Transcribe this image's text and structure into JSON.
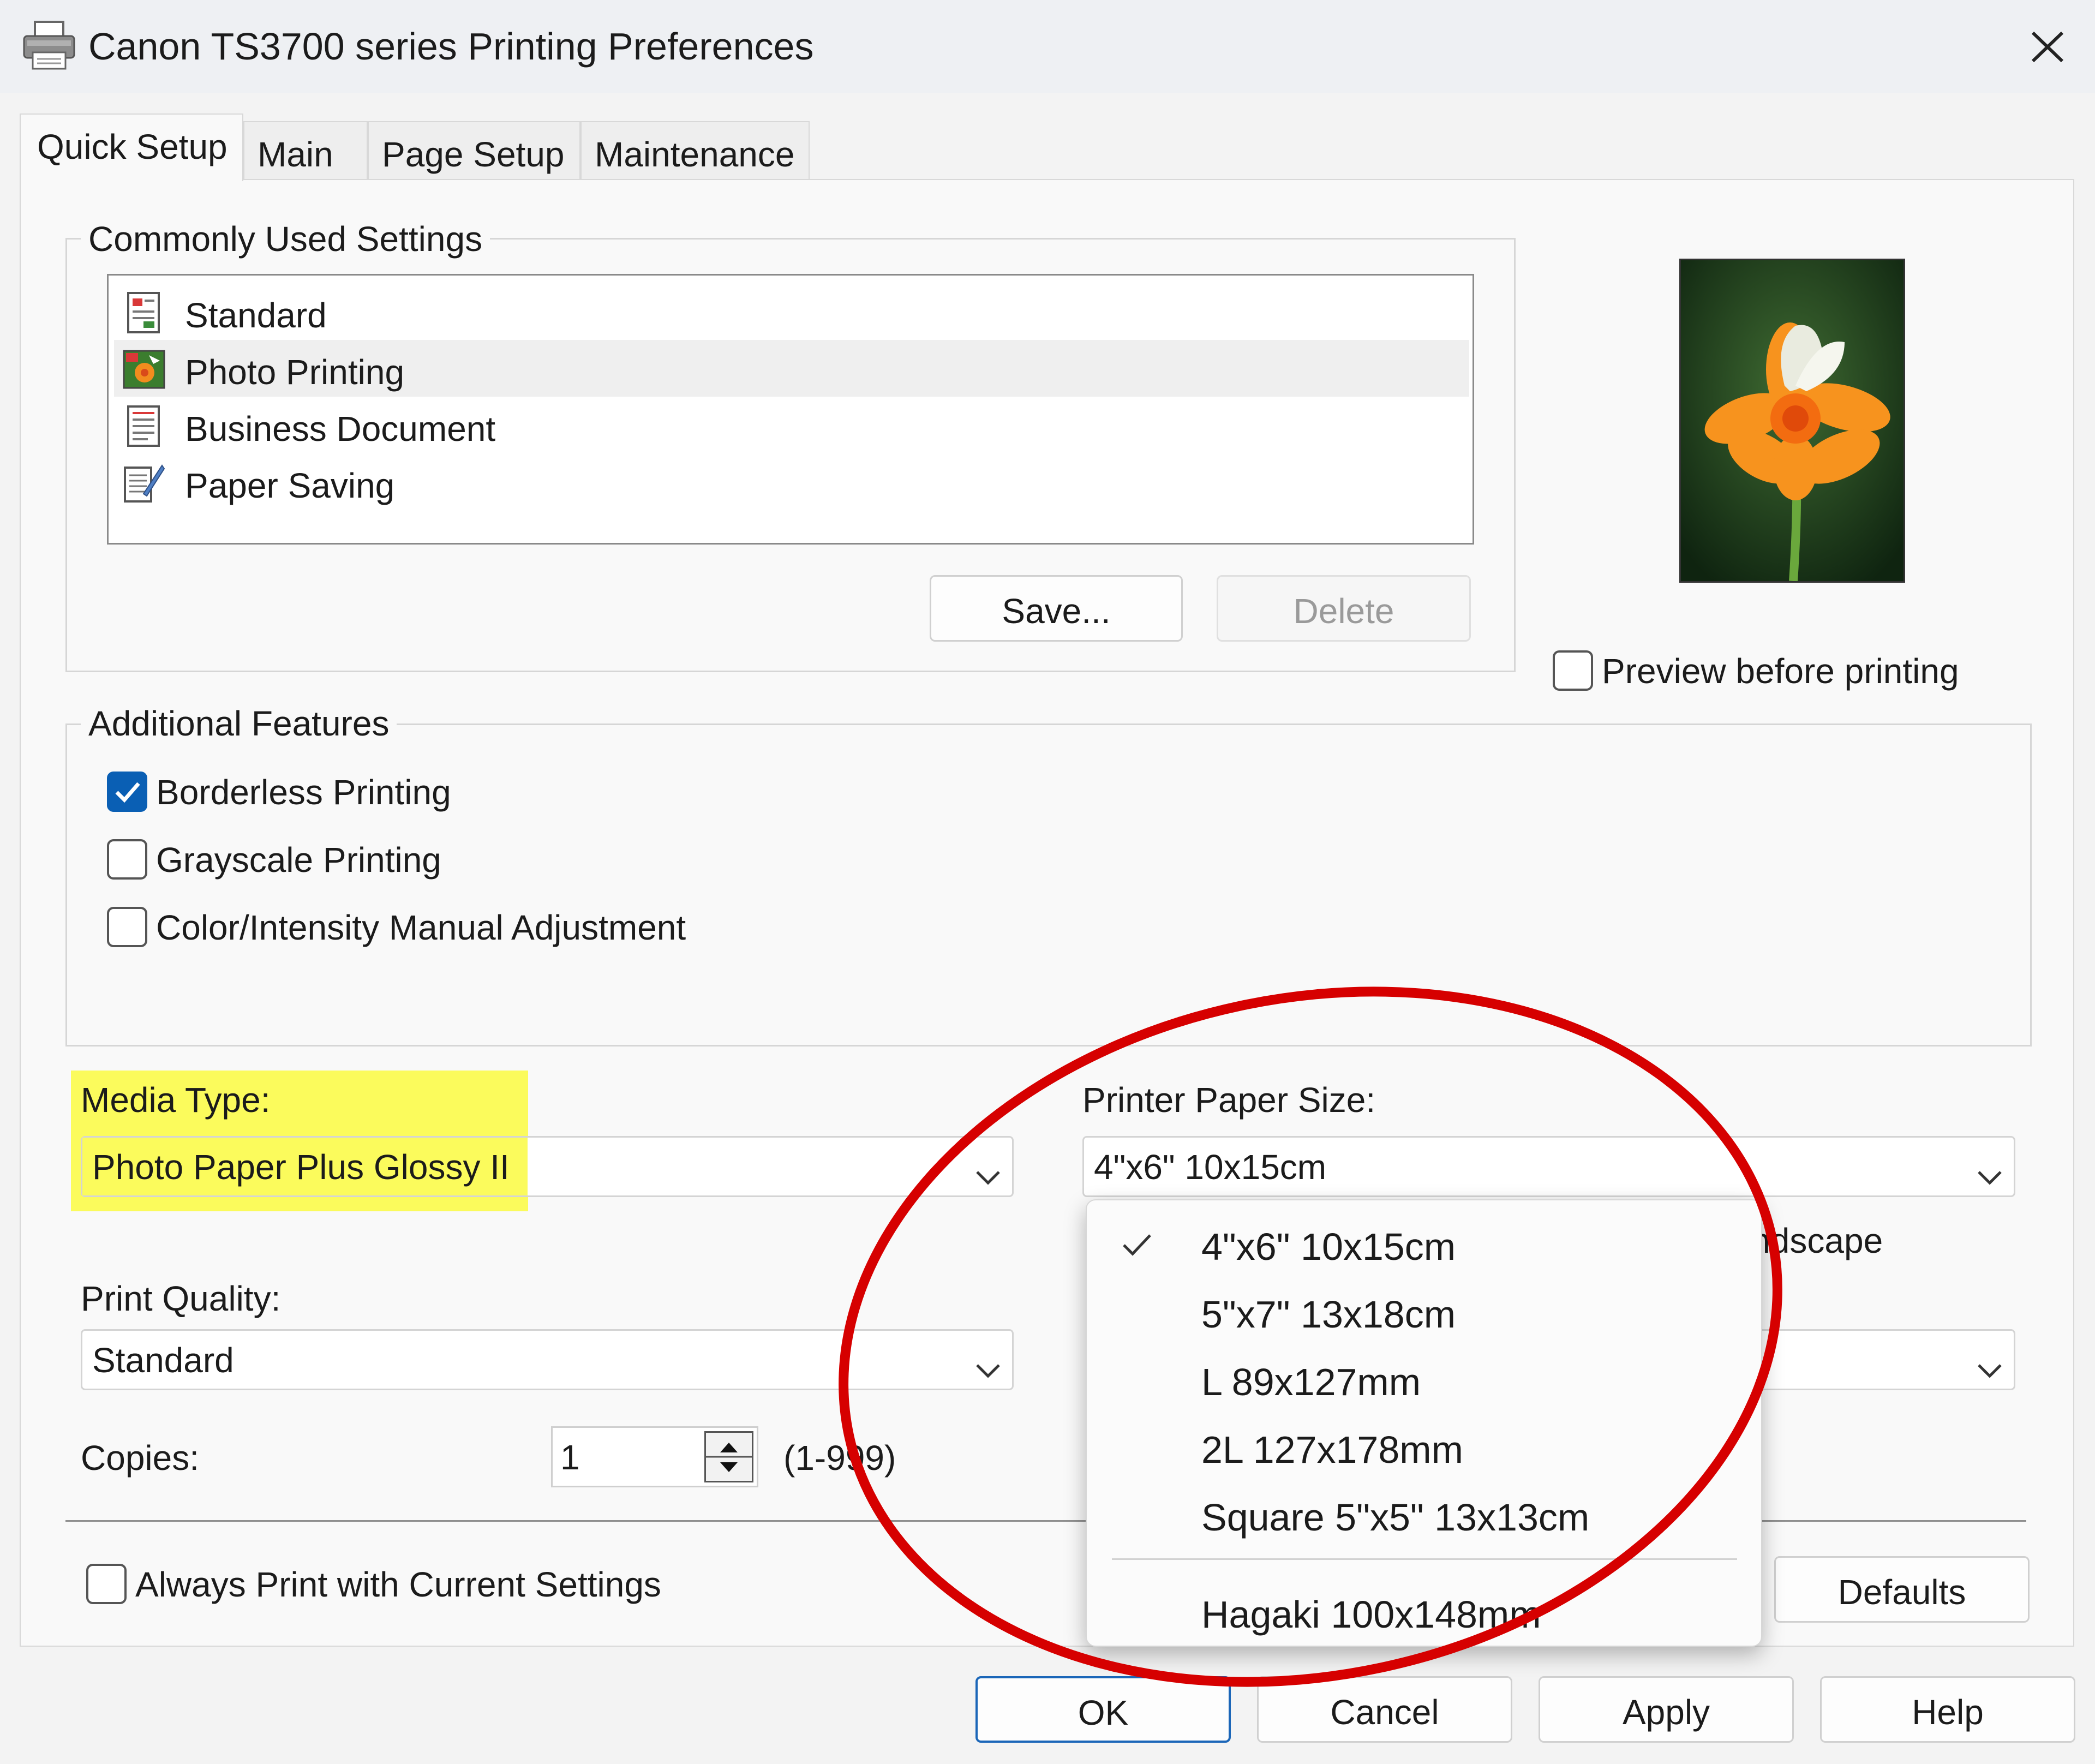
{
  "window": {
    "title": "Canon TS3700 series Printing Preferences"
  },
  "tabs": [
    {
      "label": "Quick Setup",
      "active": true
    },
    {
      "label": "Main",
      "active": false
    },
    {
      "label": "Page Setup",
      "active": false
    },
    {
      "label": "Maintenance",
      "active": false
    }
  ],
  "common_settings": {
    "legend": "Commonly Used Settings",
    "items": [
      {
        "label": "Standard",
        "icon": "standard-doc-icon"
      },
      {
        "label": "Photo Printing",
        "icon": "photo-printing-icon",
        "selected": true
      },
      {
        "label": "Business Document",
        "icon": "business-document-icon"
      },
      {
        "label": "Paper Saving",
        "icon": "paper-saving-icon"
      }
    ],
    "save_label": "Save...",
    "delete_label": "Delete"
  },
  "preview": {
    "checkbox_label": "Preview before printing",
    "checked": false
  },
  "additional_features": {
    "legend": "Additional Features",
    "options": [
      {
        "label": "Borderless Printing",
        "checked": true
      },
      {
        "label": "Grayscale Printing",
        "checked": false
      },
      {
        "label": "Color/Intensity Manual Adjustment",
        "checked": false
      }
    ]
  },
  "media_type": {
    "label": "Media Type:",
    "value": "Photo Paper Plus Glossy II",
    "highlight_color": "#fbfb5c"
  },
  "paper_size": {
    "label": "Printer Paper Size:",
    "value": "4\"x6\" 10x15cm",
    "menu": [
      {
        "label": "4\"x6\" 10x15cm",
        "checked": true
      },
      {
        "label": "5\"x7\" 13x18cm",
        "checked": false
      },
      {
        "label": "L 89x127mm",
        "checked": false
      },
      {
        "label": "2L 127x178mm",
        "checked": false
      },
      {
        "label": "Square 5\"x5\" 13x13cm",
        "checked": false
      },
      {
        "label": "Hagaki 100x148mm",
        "checked": false
      }
    ]
  },
  "orientation_partial": "Landscape",
  "print_quality": {
    "label": "Print Quality:",
    "value": "Standard"
  },
  "copies": {
    "label": "Copies:",
    "value": "1",
    "range": "(1-999)"
  },
  "always_print": {
    "label": "Always Print with Current Settings",
    "checked": false
  },
  "buttons": {
    "defaults": "Defaults",
    "ok": "OK",
    "cancel": "Cancel",
    "apply": "Apply",
    "help": "Help"
  },
  "colors": {
    "accent": "#0a5fb4",
    "annotation_red": "#d60000"
  }
}
